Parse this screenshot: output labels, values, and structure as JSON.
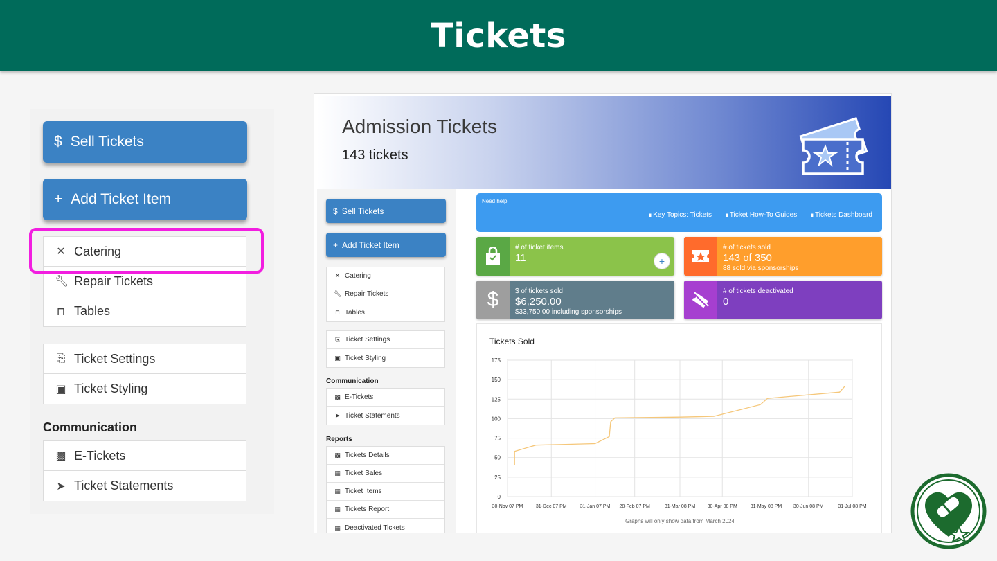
{
  "slide": {
    "title": "Tickets"
  },
  "zoom": {
    "sell_label": "Sell Tickets",
    "sell_symbol": "$",
    "add_label": "Add Ticket Item",
    "add_symbol": "+",
    "group1": [
      "Catering",
      "Repair Tickets",
      "Tables"
    ],
    "group2": [
      "Ticket Settings",
      "Ticket Styling"
    ],
    "communication_heading": "Communication",
    "group3": [
      "E-Tickets",
      "Ticket Statements"
    ]
  },
  "banner": {
    "title": "Admission Tickets",
    "subtitle": "143 tickets"
  },
  "sidebar": {
    "sell_label": "Sell Tickets",
    "add_label": "Add Ticket Item",
    "group1": [
      "Catering",
      "Repair Tickets",
      "Tables"
    ],
    "group2": [
      "Ticket Settings",
      "Ticket Styling"
    ],
    "communication_heading": "Communication",
    "group3": [
      "E-Tickets",
      "Ticket Statements"
    ],
    "reports_heading": "Reports",
    "group4": [
      "Tickets Details",
      "Ticket Sales",
      "Ticket Items",
      "Tickets Report",
      "Deactivated Tickets"
    ]
  },
  "help": {
    "label": "Need help:",
    "links": [
      "Key Topics: Tickets",
      "Ticket How-To Guides",
      "Tickets Dashboard"
    ]
  },
  "cards": {
    "items": {
      "label": "# of ticket items",
      "value": "11",
      "plus": "+",
      "color": "#8bc34a"
    },
    "sold": {
      "label": "# of tickets sold",
      "value": "143 of 350",
      "sub": "88 sold via sponsorships",
      "color": "#ff9e2c"
    },
    "revenue": {
      "label": "$ of tickets sold",
      "value": "$6,250.00",
      "sub": "$33,750.00 including sponsorships",
      "color": "#607d8b"
    },
    "deactivated": {
      "label": "# of tickets deactivated",
      "value": "0",
      "color": "#7e3fbf"
    }
  },
  "chart_data": {
    "type": "line",
    "title": "Tickets Sold",
    "note": "Graphs will only show data from March 2024",
    "x_ticks": [
      "30-Nov 07 PM",
      "31-Dec 07 PM",
      "31-Jan 07 PM",
      "28-Feb 07 PM",
      "31-Mar 08 PM",
      "30-Apr 08 PM",
      "31-May 08 PM",
      "30-Jun 08 PM",
      "31-Jul 08 PM"
    ],
    "y_ticks": [
      0,
      25,
      50,
      75,
      100,
      125,
      150,
      175
    ],
    "ylim": [
      0,
      175
    ],
    "grid": true,
    "series": [
      {
        "color": "#f5c77a",
        "points": [
          [
            "2023-12-05",
            40
          ],
          [
            "2023-12-05",
            58
          ],
          [
            "2023-12-20",
            66
          ],
          [
            "2024-01-10",
            67
          ],
          [
            "2024-01-31",
            68
          ],
          [
            "2024-02-10",
            77
          ],
          [
            "2024-02-11",
            96
          ],
          [
            "2024-02-14",
            101
          ],
          [
            "2024-03-31",
            102
          ],
          [
            "2024-04-24",
            103
          ],
          [
            "2024-05-27",
            118
          ],
          [
            "2024-06-01",
            126
          ],
          [
            "2024-07-22",
            134
          ],
          [
            "2024-07-26",
            142
          ]
        ]
      }
    ]
  }
}
